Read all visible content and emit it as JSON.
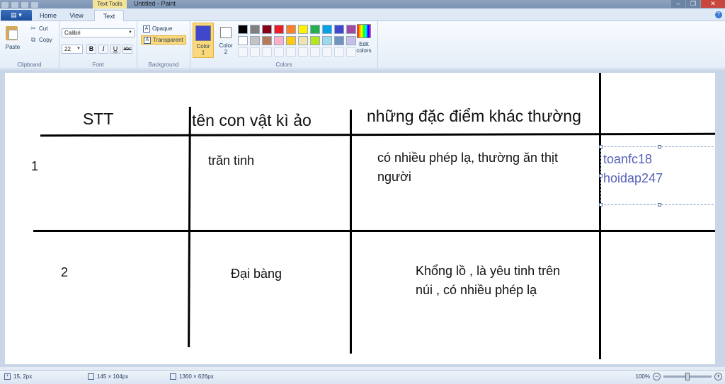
{
  "window": {
    "title": "Untitled - Paint",
    "contextual_tab": "Text Tools",
    "controls": [
      "–",
      "❐",
      "✕"
    ]
  },
  "tabs": {
    "app_menu": "▤ ▾",
    "items": [
      "Home",
      "View",
      "Text"
    ],
    "active": "Text",
    "help": "?"
  },
  "ribbon": {
    "clipboard": {
      "paste": "Paste",
      "cut": "Cut",
      "copy": "Copy",
      "label": "Clipboard"
    },
    "font": {
      "family": "Calibri",
      "size": "22",
      "bold": "B",
      "italic": "I",
      "underline": "U",
      "strike": "abc",
      "label": "Font"
    },
    "background": {
      "opaque": "Opaque",
      "transparent": "Transparent",
      "selected": "Transparent",
      "label": "Background"
    },
    "colors": {
      "color1_label": "Color\n1",
      "color2_label": "Color\n2",
      "color1": "#3f48cc",
      "color2": "#ffffff",
      "palette_row1": [
        "#000000",
        "#7f7f7f",
        "#880015",
        "#ed1c24",
        "#ff7f27",
        "#fff200",
        "#22b14c",
        "#00a2e8",
        "#3f48cc",
        "#a349a4"
      ],
      "palette_row2": [
        "#ffffff",
        "#c3c3c3",
        "#b97a57",
        "#ffaec9",
        "#ffc90e",
        "#efe4b0",
        "#b5e61d",
        "#99d9ea",
        "#7092be",
        "#c8bfe7"
      ],
      "palette_custom_slots": 10,
      "edit_colors": "Edit colors",
      "label": "Colors"
    }
  },
  "canvas": {
    "headers": {
      "col1": "STT",
      "col2": "tên con vật kì ảo",
      "col3": "những đặc điểm khác thường"
    },
    "rows": [
      {
        "stt": "1",
        "name": "trăn tinh",
        "traits": "có nhiều phép lạ, thường ăn thịt người"
      },
      {
        "stt": "2",
        "name": "Đại bàng",
        "traits": "Khổng lồ , là yêu tinh trên núi , có nhiều phép lạ"
      }
    ],
    "text_box": "toanfc18\nhoidap247"
  },
  "status": {
    "cursor": "15, 2px",
    "selection": "145 × 104px",
    "image_size": "1360 × 626px",
    "zoom": "100%",
    "zoom_level_fraction": 0.5
  }
}
